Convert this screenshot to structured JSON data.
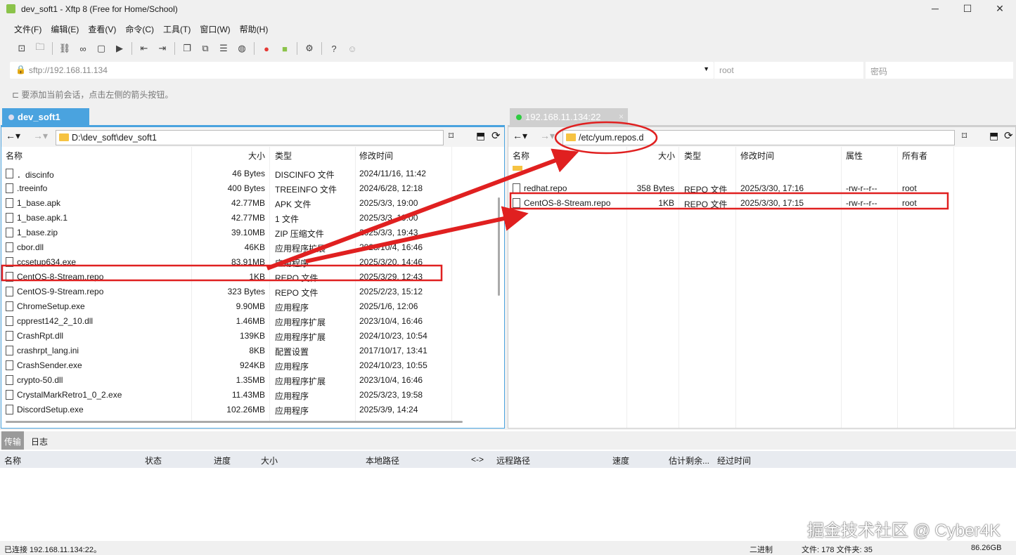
{
  "window": {
    "title": "dev_soft1 - Xftp 8 (Free for Home/School)",
    "minimize": "─",
    "maximize": "☐",
    "close": "✕"
  },
  "menu": [
    "文件(F)",
    "编辑(E)",
    "查看(V)",
    "命令(C)",
    "工具(T)",
    "窗口(W)",
    "帮助(H)"
  ],
  "address": {
    "value": "sftp://192.168.11.134",
    "user_placeholder": "root",
    "password_placeholder": "密码"
  },
  "hint": "要添加当前会话，点击左侧的箭头按钮。",
  "left": {
    "tab": "dev_soft1",
    "path": "D:\\dev_soft\\dev_soft1",
    "columns": [
      "名称",
      "大小",
      "类型",
      "修改时间"
    ],
    "files": [
      [
        "．discinfo",
        "46 Bytes",
        "DISCINFO 文件",
        "2024/11/16, 11:42"
      ],
      [
        ".treeinfo",
        "400 Bytes",
        "TREEINFO 文件",
        "2024/6/28, 12:18"
      ],
      [
        "1_base.apk",
        "42.77MB",
        "APK 文件",
        "2025/3/3, 19:00"
      ],
      [
        "1_base.apk.1",
        "42.77MB",
        "1 文件",
        "2025/3/3, 19:00"
      ],
      [
        "1_base.zip",
        "39.10MB",
        "ZIP 压缩文件",
        "2025/3/3, 19:43"
      ],
      [
        "cbor.dll",
        "46KB",
        "应用程序扩展",
        "2023/10/4, 16:46"
      ],
      [
        "ccsetup634.exe",
        "83.91MB",
        "应用程序",
        "2025/3/20, 14:46"
      ],
      [
        "CentOS-8-Stream.repo",
        "1KB",
        "REPO 文件",
        "2025/3/29, 12:43"
      ],
      [
        "CentOS-9-Stream.repo",
        "323 Bytes",
        "REPO 文件",
        "2025/2/23, 15:12"
      ],
      [
        "ChromeSetup.exe",
        "9.90MB",
        "应用程序",
        "2025/1/6, 12:06"
      ],
      [
        "cpprest142_2_10.dll",
        "1.46MB",
        "应用程序扩展",
        "2023/10/4, 16:46"
      ],
      [
        "CrashRpt.dll",
        "139KB",
        "应用程序扩展",
        "2024/10/23, 10:54"
      ],
      [
        "crashrpt_lang.ini",
        "8KB",
        "配置设置",
        "2017/10/17, 13:41"
      ],
      [
        "CrashSender.exe",
        "924KB",
        "应用程序",
        "2024/10/23, 10:55"
      ],
      [
        "crypto-50.dll",
        "1.35MB",
        "应用程序扩展",
        "2023/10/4, 16:46"
      ],
      [
        "CrystalMarkRetro1_0_2.exe",
        "11.43MB",
        "应用程序",
        "2025/3/23, 19:58"
      ],
      [
        "DiscordSetup.exe",
        "102.26MB",
        "应用程序",
        "2025/3/9, 14:24"
      ]
    ]
  },
  "right": {
    "tab": "192.168.11.134:22",
    "path": "/etc/yum.repos.d",
    "columns": [
      "名称",
      "大小",
      "类型",
      "修改时间",
      "属性",
      "所有者"
    ],
    "files": [
      [
        "redhat.repo",
        "358 Bytes",
        "REPO 文件",
        "2025/3/30, 17:16",
        "-rw-r--r--",
        "root"
      ],
      [
        "CentOS-8-Stream.repo",
        "1KB",
        "REPO 文件",
        "2025/3/30, 17:15",
        "-rw-r--r--",
        "root"
      ]
    ]
  },
  "bottom": {
    "tabs": [
      "传输",
      "日志"
    ],
    "columns": [
      "名称",
      "状态",
      "进度",
      "大小",
      "本地路径",
      "<->",
      "远程路径",
      "速度",
      "估计剩余...",
      "经过时间"
    ]
  },
  "status": {
    "connection": "已连接 192.168.11.134:22。",
    "mode": "二进制",
    "counts": "文件: 178  文件夹: 35",
    "free": "86.26GB"
  },
  "watermark": "掘金技术社区 @ Cyber4K",
  "colors": {
    "accent": "#4aa3df",
    "annotation": "#e02020"
  }
}
